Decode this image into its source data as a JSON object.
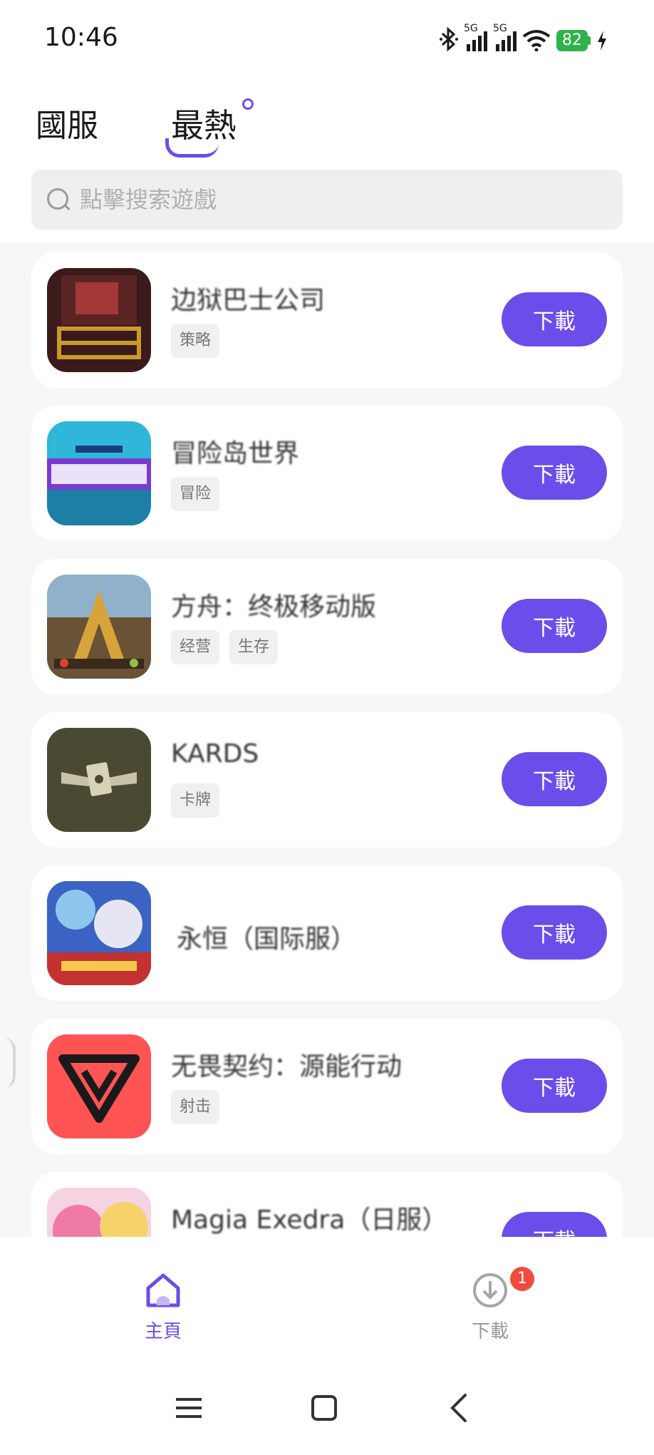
{
  "status_bar": {
    "time": "10:46",
    "signal_label_1": "5G",
    "signal_label_2": "5G",
    "battery": "82"
  },
  "header": {
    "tabs": [
      {
        "label": "國服",
        "active": false
      },
      {
        "label": "最熱",
        "active": true
      }
    ],
    "accent_color": "#6b4dea"
  },
  "search": {
    "placeholder": "點擊搜索遊戲"
  },
  "games": [
    {
      "title": "边狱巴士公司",
      "tags": [
        "策略"
      ],
      "button": "下載",
      "icon": "limbus-company-icon"
    },
    {
      "title": "冒险岛世界",
      "tags": [
        "冒险"
      ],
      "button": "下載",
      "icon": "maplestory-worlds-icon"
    },
    {
      "title": "方舟：终极移动版",
      "tags": [
        "经营",
        "生存"
      ],
      "button": "下載",
      "icon": "ark-mobile-icon"
    },
    {
      "title": "KARDS",
      "tags": [
        "卡牌"
      ],
      "button": "下載",
      "icon": "kards-icon"
    },
    {
      "title": "永恒（国际服）",
      "tags": [],
      "button": "下載",
      "icon": "eternal-icon"
    },
    {
      "title": "无畏契约：源能行动",
      "tags": [
        "射击"
      ],
      "button": "下載",
      "icon": "valorant-icon"
    },
    {
      "title": "Magia Exedra（日服）",
      "tags": [],
      "button": "下載",
      "icon": "magia-exedra-icon"
    }
  ],
  "bottom_nav": {
    "home_label": "主頁",
    "download_label": "下載",
    "download_badge": "1"
  }
}
